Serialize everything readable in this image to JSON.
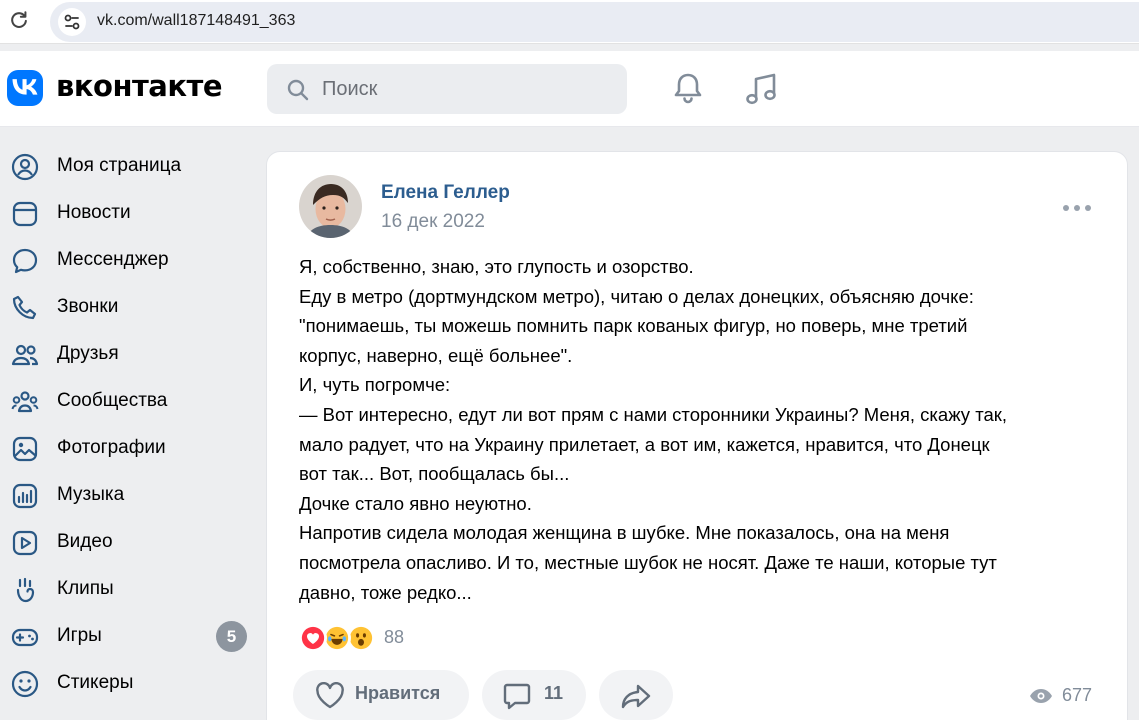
{
  "browser": {
    "url": "vk.com/wall187148491_363"
  },
  "header": {
    "brand": "вконтакте",
    "search_placeholder": "Поиск"
  },
  "sidebar": {
    "items": [
      {
        "label": "Моя страница",
        "icon": "user-circle-icon"
      },
      {
        "label": "Новости",
        "icon": "news-icon"
      },
      {
        "label": "Мессенджер",
        "icon": "message-icon"
      },
      {
        "label": "Звонки",
        "icon": "phone-icon"
      },
      {
        "label": "Друзья",
        "icon": "friends-icon"
      },
      {
        "label": "Сообщества",
        "icon": "communities-icon"
      },
      {
        "label": "Фотографии",
        "icon": "photo-icon"
      },
      {
        "label": "Музыка",
        "icon": "music-icon"
      },
      {
        "label": "Видео",
        "icon": "video-icon"
      },
      {
        "label": "Клипы",
        "icon": "clips-icon"
      },
      {
        "label": "Игры",
        "icon": "gamepad-icon",
        "badge": "5"
      },
      {
        "label": "Стикеры",
        "icon": "smile-icon"
      }
    ]
  },
  "post": {
    "author": "Елена Геллер",
    "date": "16 дек 2022",
    "lines": [
      "Я, собственно, знаю, это глупость и озорство.",
      "Еду в метро (дортмундском метро), читаю о делах донецких, объясняю дочке:",
      "\"понимаешь, ты можешь помнить парк кованых фигур, но поверь, мне третий",
      "корпус, наверно, ещё больнее\".",
      "И, чуть погромче:",
      "— Вот интересно, едут ли вот прям с нами сторонники Украины? Меня, скажу так,",
      "мало радует, что на Украину прилетает, а вот им, кажется, нравится, что Донецк",
      "вот так... Вот, пообщалась бы...",
      "Дочке стало явно неуютно.",
      "Напротив сидела молодая женщина в шубке. Мне показалось, она на меня",
      "посмотрела опасливо. И то, местные шубок не носят. Даже те наши, которые тут",
      "давно, тоже редко..."
    ],
    "reactions_count": "88",
    "like_label": "Нравится",
    "comments_count": "11",
    "views_count": "677"
  },
  "colors": {
    "vk_blue": "#0077ff",
    "author_link": "#2c5d8f",
    "secondary_text": "#818c99",
    "icon_blue": "#2a5885",
    "badge_gray": "#8d959f"
  }
}
